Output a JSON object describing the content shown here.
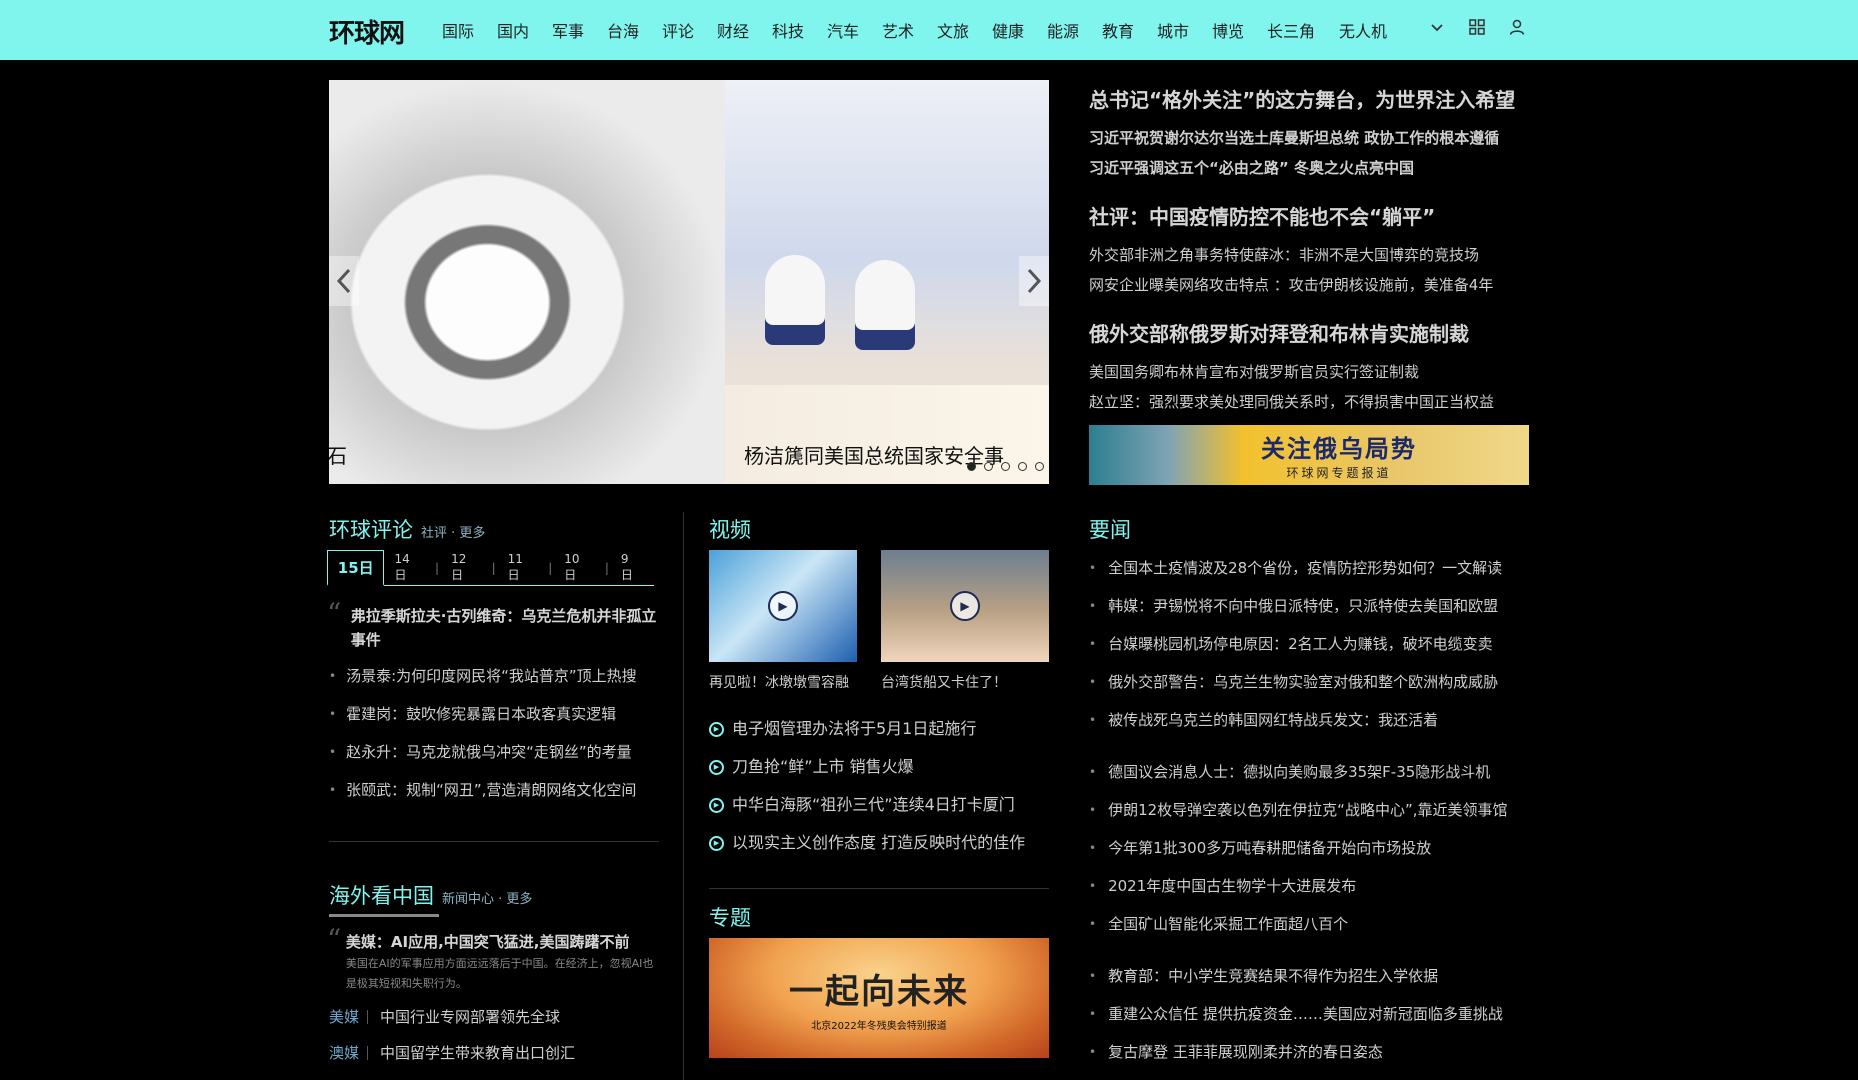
{
  "header": {
    "logo": "环球网",
    "nav": [
      "国际",
      "国内",
      "军事",
      "台海",
      "评论",
      "财经",
      "科技",
      "汽车",
      "艺术",
      "文旅",
      "健康",
      "能源",
      "教育",
      "城市",
      "博览",
      "长三角",
      "无人机"
    ]
  },
  "slider": {
    "caption_left": "石",
    "caption": "杨洁篪同美国总统国家安全事"
  },
  "headlines": [
    {
      "main": "总书记“格外关注”的这方舞台，为世界注入希望",
      "subs": [
        "习近平祝贺谢尔达尔当选土库曼斯坦总统 政协工作的根本遵循",
        "习近平强调这五个“必由之路” 冬奥之火点亮中国"
      ],
      "bold": true
    },
    {
      "main": "社评：中国疫情防控不能也不会“躺平”",
      "subs": [
        "外交部非洲之角事务特使薛冰：非洲不是大国博弈的竞技场",
        "网安企业曝美网络攻击特点 ：攻击伊朗核设施前，美准备4年"
      ],
      "bold": false
    },
    {
      "main": "俄外交部称俄罗斯对拜登和布林肯实施制裁",
      "subs": [
        "美国国务卿布林肯宣布对俄罗斯官员实行签证制裁",
        "赵立坚：强烈要求美处理同俄关系时，不得损害中国正当权益"
      ],
      "bold": false
    }
  ],
  "banner": {
    "title": "关注俄乌局势",
    "sub": "环球网专题报道"
  },
  "comment": {
    "title": "环球评论",
    "links": "社评 · 更多",
    "tabs": [
      "15日",
      "14日",
      "12日",
      "11日",
      "10日",
      "9日"
    ],
    "quote": "弗拉季斯拉夫·古列维奇：乌克兰危机并非孤立事件",
    "items": [
      "汤景泰:为何印度网民将“我站普京”顶上热搜",
      "霍建岗：鼓吹修宪暴露日本政客真实逻辑",
      "赵永升：马克龙就俄乌冲突“走钢丝”的考量",
      "张颐武：规制“网丑”,营造清朗网络文化空间"
    ]
  },
  "overseas": {
    "title": "海外看中国",
    "links": "新闻中心 · 更多",
    "quote": "美媒：AI应用,中国突飞猛进,美国踌躇不前",
    "desc": "美国在AI的军事应用方面远远落后于中国。在经济上，忽视AI也是极其短视和失职行为。",
    "rows": [
      {
        "tag": "美媒",
        "text": "中国行业专网部署领先全球"
      },
      {
        "tag": "澳媒",
        "text": "中国留学生带来教育出口创汇"
      }
    ]
  },
  "video": {
    "title": "视频",
    "thumbs": [
      "再见啦！冰墩墩雪容融",
      "台湾货船又卡住了！"
    ],
    "items": [
      "电子烟管理办法将于5月1日起施行",
      "刀鱼抢“鲜”上市 销售火爆",
      "中华白海豚“祖孙三代”连续4日打卡厦门",
      "以现实主义创作态度 打造反映时代的佳作"
    ]
  },
  "topic": {
    "title": "专题",
    "banner_title": "一起向未来",
    "banner_sub": "北京2022年冬残奥会特别报道"
  },
  "news": {
    "title": "要闻",
    "group1": [
      "全国本土疫情波及28个省份，疫情防控形势如何？一文解读",
      "韩媒：尹锡悦将不向中俄日派特使，只派特使去美国和欧盟",
      "台媒曝桃园机场停电原因：2名工人为赚钱，破坏电缆变卖",
      "俄外交部警告：乌克兰生物实验室对俄和整个欧洲构成威胁",
      "被传战死乌克兰的韩国网红特战兵发文：我还活着"
    ],
    "group2": [
      "德国议会消息人士：德拟向美购最多35架F-35隐形战斗机",
      "伊朗12枚导弹空袭以色列在伊拉克“战略中心”,靠近美领事馆",
      "今年第1批300多万吨春耕肥储备开始向市场投放",
      "2021年度中国古生物学十大进展发布",
      "全国矿山智能化采掘工作面超八百个"
    ],
    "group3": [
      "教育部：中小学生竞赛结果不得作为招生入学依据",
      "重建公众信任 提供抗疫资金……美国应对新冠面临多重挑战",
      "复古摩登 王菲菲展现刚柔并济的春日姿态"
    ]
  }
}
